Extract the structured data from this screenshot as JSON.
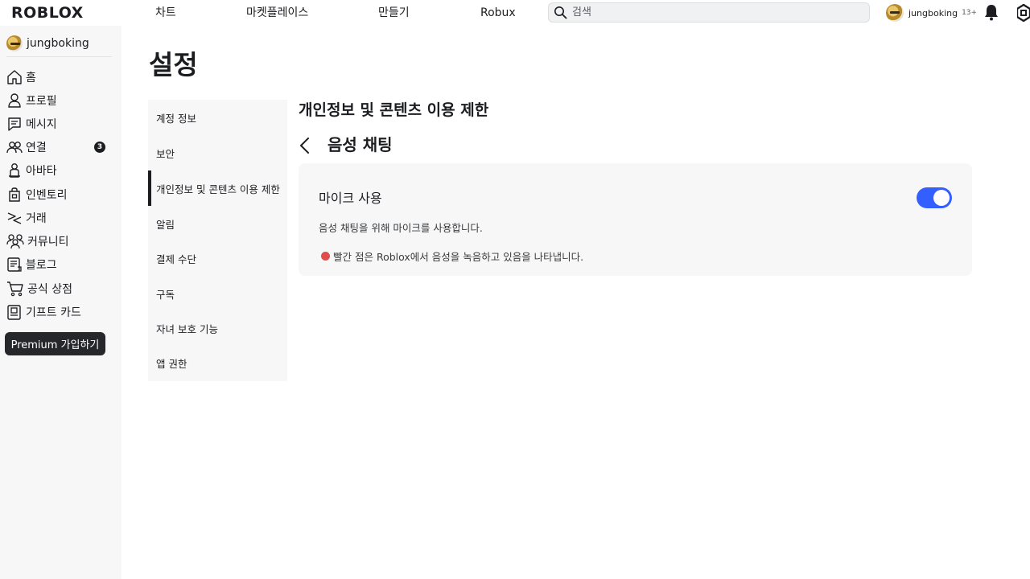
{
  "topbar": {
    "logo": "ROBLOX",
    "nav": [
      "차트",
      "마켓플레이스",
      "만들기",
      "Robux"
    ],
    "search_placeholder": "검색",
    "username": "jungboking",
    "age_label": "13+"
  },
  "sidebar": {
    "username": "jungboking",
    "items": [
      {
        "label": "홈",
        "icon": "home-icon"
      },
      {
        "label": "프로필",
        "icon": "profile-icon"
      },
      {
        "label": "메시지",
        "icon": "messages-icon"
      },
      {
        "label": "연결",
        "icon": "friends-icon",
        "badge": "3"
      },
      {
        "label": "아바타",
        "icon": "avatar-icon"
      },
      {
        "label": "인벤토리",
        "icon": "inventory-icon"
      },
      {
        "label": "거래",
        "icon": "trade-icon"
      },
      {
        "label": "커뮤니티",
        "icon": "community-icon"
      },
      {
        "label": "블로그",
        "icon": "blog-icon"
      },
      {
        "label": "공식 상점",
        "icon": "shop-cart-icon"
      },
      {
        "label": "기프트 카드",
        "icon": "gift-card-icon"
      }
    ],
    "premium_button": "Premium 가입하기"
  },
  "main": {
    "page_title": "설정",
    "menu": [
      {
        "label": "계정 정보",
        "active": false
      },
      {
        "label": "보안",
        "active": false
      },
      {
        "label": "개인정보 및 콘텐츠 이용 제한",
        "active": true
      },
      {
        "label": "알림",
        "active": false
      },
      {
        "label": "결제 수단",
        "active": false
      },
      {
        "label": "구독",
        "active": false
      },
      {
        "label": "자녀 보호 기능",
        "active": false
      },
      {
        "label": "앱 권한",
        "active": false
      }
    ],
    "section_title": "개인정보 및 콘텐츠 이용 제한",
    "sub_title": "음성 채팅",
    "card": {
      "title": "마이크 사용",
      "toggle_on": true,
      "description": "음성 채팅을 위해 마이크를 사용합니다.",
      "note": "빨간 점은 Roblox에서 음성을 녹음하고 있음을 나타냅니다."
    }
  },
  "colors": {
    "accent": "#335fff",
    "recording_dot": "#e24c4b",
    "sidebar_bg": "#f7f7f8"
  }
}
